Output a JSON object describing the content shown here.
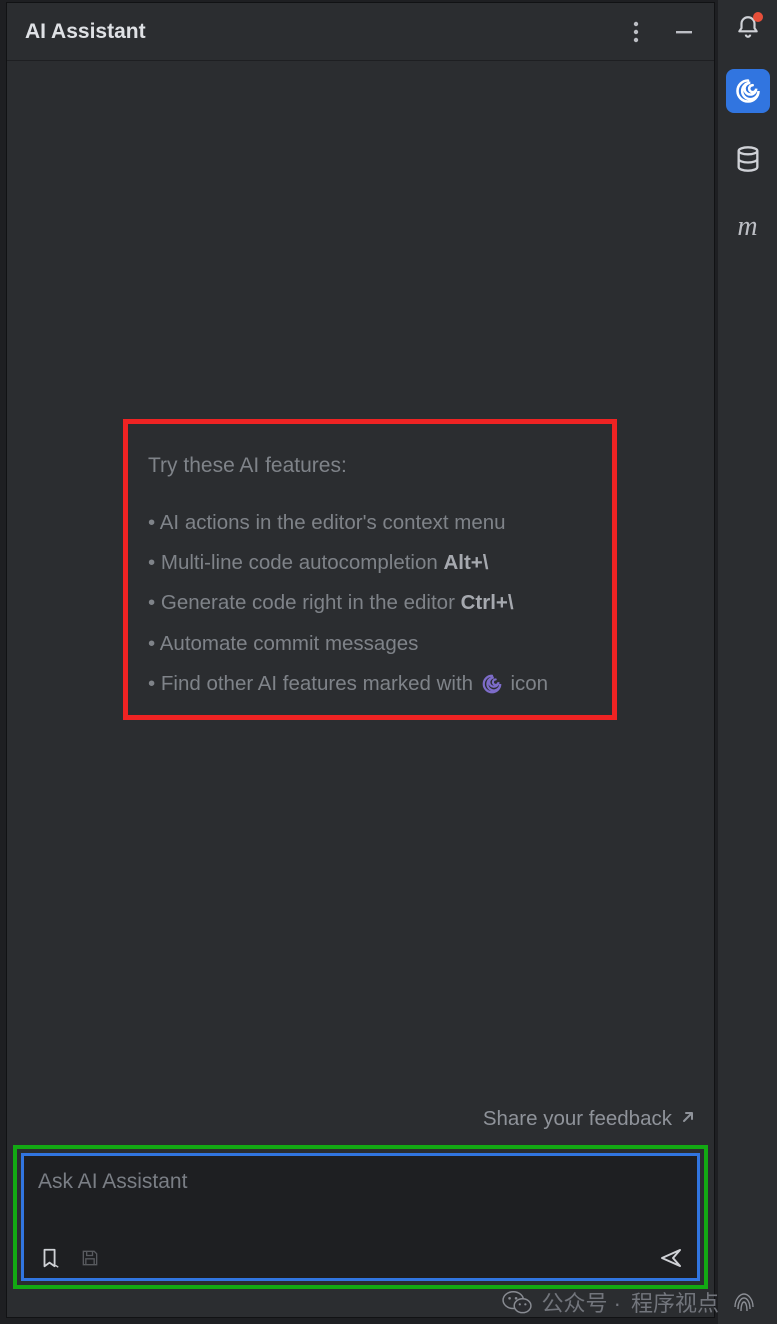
{
  "header": {
    "title": "AI Assistant"
  },
  "tips": {
    "heading": "Try these AI features:",
    "items": {
      "i0": "AI actions in the editor's context menu",
      "i1_pre": "Multi-line code autocompletion ",
      "i1_kbd": "Alt+\\",
      "i2_pre": "Generate code right in the editor ",
      "i2_kbd": "Ctrl+\\",
      "i3": "Automate commit messages",
      "i4_pre": "Find other AI features marked with ",
      "i4_post": " icon"
    }
  },
  "feedback": {
    "label": "Share your feedback"
  },
  "input": {
    "placeholder": "Ask AI Assistant"
  },
  "watermark": {
    "prefix": "公众号 · ",
    "account": "程序视点"
  }
}
